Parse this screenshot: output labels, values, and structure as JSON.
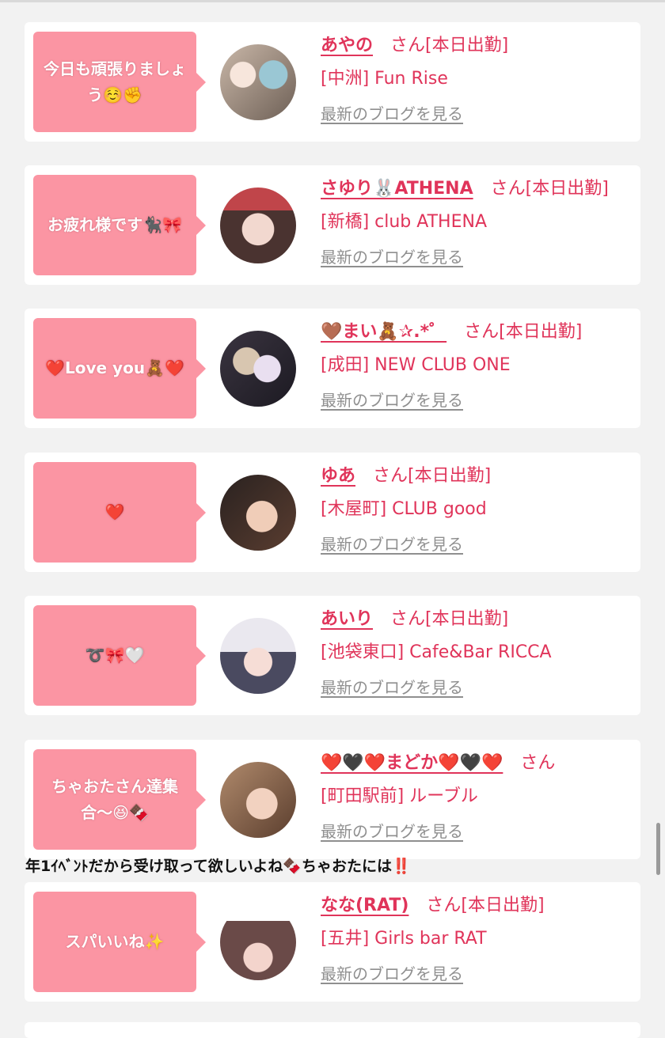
{
  "colors": {
    "bubble": "#fb95a3",
    "accent": "#e0345a",
    "link_gray": "#8f8f8f",
    "card": "#ffffff",
    "background": "#f2f2f2"
  },
  "san_label": "さん",
  "blog_link": "最新のブログを見る",
  "cards": [
    {
      "message": "今日も頑張りましょう☺️✊",
      "name": "あやの",
      "status": "[本日出勤]",
      "shop": "[中洲] Fun Rise",
      "avatar": "avatar-photo"
    },
    {
      "message": "お疲れ様です🐈‍⬛🎀",
      "name": "さゆり🐰ATHENA",
      "status": "[本日出勤]",
      "shop": "[新橋] club ATHENA",
      "avatar": "avatar-photo"
    },
    {
      "message": "❤️Love you🧸❤️",
      "name": "🤎まい🧸✰.*゜",
      "status": "[本日出勤]",
      "shop": "[成田] NEW CLUB ONE",
      "avatar": "avatar-photo"
    },
    {
      "message": "❤️",
      "name": "ゆあ",
      "status": "[本日出勤]",
      "shop": "[木屋町] CLUB good",
      "avatar": "avatar-photo"
    },
    {
      "message": "➰🎀🤍",
      "name": "あいり",
      "status": "[本日出勤]",
      "shop": "[池袋東口] Cafe&Bar RICCA",
      "avatar": "avatar-photo"
    },
    {
      "message": "ちゃおたさん達集合〜😆🍫",
      "name": "❤️🖤❤️まどか❤️🖤❤️",
      "status": "",
      "shop": "[町田駅前] ルーブル",
      "avatar": "avatar-photo"
    },
    {
      "message": "スパいいね✨",
      "name": "なな(RAT)",
      "status": "[本日出勤]",
      "shop": "[五井] Girls bar RAT",
      "avatar": "avatar-photo"
    }
  ],
  "overlay_caption": "年1ｲﾍﾞﾝﾄだから受け取って欲しいよね🍫ちゃおたには‼️"
}
